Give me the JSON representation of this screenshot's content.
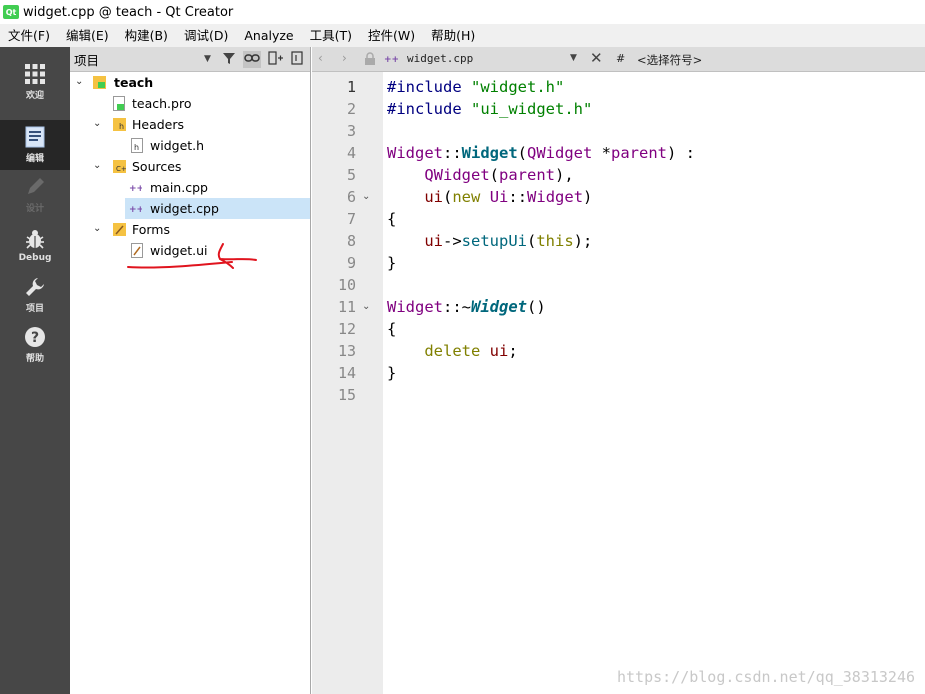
{
  "window": {
    "title": "widget.cpp @ teach - Qt Creator",
    "app_icon": "qt"
  },
  "menu": [
    "文件(F)",
    "编辑(E)",
    "构建(B)",
    "调试(D)",
    "Analyze",
    "工具(T)",
    "控件(W)",
    "帮助(H)"
  ],
  "modes": [
    {
      "label": "欢迎",
      "icon": "grid-icon"
    },
    {
      "label": "编辑",
      "icon": "edit-doc-icon",
      "active": true
    },
    {
      "label": "设计",
      "icon": "pencil-icon",
      "disabled": true
    },
    {
      "label": "Debug",
      "icon": "bug-icon"
    },
    {
      "label": "项目",
      "icon": "wrench-icon"
    },
    {
      "label": "帮助",
      "icon": "help-icon"
    }
  ],
  "project_panel": {
    "title": "项目",
    "tree": [
      {
        "label": "teach",
        "bold": true
      },
      {
        "label": "teach.pro"
      },
      {
        "label": "Headers"
      },
      {
        "label": "widget.h"
      },
      {
        "label": "Sources"
      },
      {
        "label": "main.cpp"
      },
      {
        "label": "widget.cpp",
        "selected": true
      },
      {
        "label": "Forms"
      },
      {
        "label": "widget.ui"
      }
    ]
  },
  "editor": {
    "file_tab": "widget.cpp",
    "hash": "#",
    "symbol_combo": "<选择符号>",
    "current_line": 1,
    "line_numbers": [
      "1",
      "2",
      "3",
      "4",
      "5",
      "6",
      "7",
      "8",
      "9",
      "10",
      "11",
      "12",
      "13",
      "14",
      "15"
    ],
    "lines": [
      "#include \"widget.h\"",
      "#include \"ui_widget.h\"",
      "",
      "Widget::Widget(QWidget *parent) :",
      "    QWidget(parent),",
      "    ui(new Ui::Widget)",
      "{",
      "    ui->setupUi(this);",
      "}",
      "",
      "Widget::~Widget()",
      "{",
      "    delete ui;",
      "}",
      ""
    ]
  },
  "annotation_color": "#e0141e",
  "watermark": "https://blog.csdn.net/qq_38313246"
}
